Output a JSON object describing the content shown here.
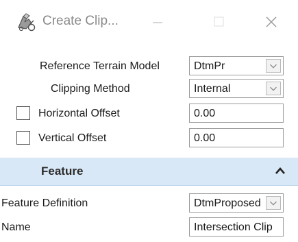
{
  "window": {
    "title": "Create Clip...",
    "app_icon": "create-clip-tool-icon",
    "controls": [
      "minimize-icon",
      "maximize-icon",
      "close-icon"
    ]
  },
  "parameters": {
    "reference_terrain_model": {
      "label": "Reference Terrain Model",
      "value": "DtmPr"
    },
    "clipping_method": {
      "label": "Clipping Method",
      "value": "Internal"
    },
    "horizontal_offset": {
      "label": "Horizontal Offset",
      "value": "0.00",
      "checked": false
    },
    "vertical_offset": {
      "label": "Vertical Offset",
      "value": "0.00",
      "checked": false
    }
  },
  "feature_section": {
    "title": "Feature",
    "expanded": true,
    "feature_definition": {
      "label": "Feature Definition",
      "value": "DtmProposed"
    },
    "name": {
      "label": "Name",
      "value": "Intersection Clip"
    }
  },
  "colors": {
    "section_header_bg": "#d9e8f6",
    "field_border": "#9a9a9a",
    "title_text": "#8a8a8a"
  }
}
